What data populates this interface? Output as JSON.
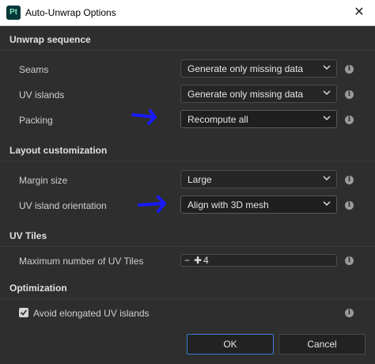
{
  "window": {
    "title": "Auto-Unwrap Options",
    "app_icon": "Pt",
    "close": "✕"
  },
  "sections": {
    "unwrap": "Unwrap sequence",
    "layout": "Layout customization",
    "uvtiles": "UV Tiles",
    "optimization": "Optimization"
  },
  "rows": {
    "seams": {
      "label": "Seams",
      "value": "Generate only missing data"
    },
    "islands": {
      "label": "UV islands",
      "value": "Generate only missing data"
    },
    "packing": {
      "label": "Packing",
      "value": "Recompute all"
    },
    "margin": {
      "label": "Margin size",
      "value": "Large"
    },
    "orientation": {
      "label": "UV island orientation",
      "value": "Align with 3D mesh"
    },
    "tiles": {
      "label": "Maximum number of UV Tiles",
      "value": "4"
    }
  },
  "checkbox": {
    "label": "Avoid elongated UV islands",
    "checked": true
  },
  "buttons": {
    "ok": "OK",
    "cancel": "Cancel"
  },
  "colors": {
    "annotation_arrow": "#1a1aff",
    "accent": "#3d7bd6",
    "background": "#2e2e2e"
  }
}
